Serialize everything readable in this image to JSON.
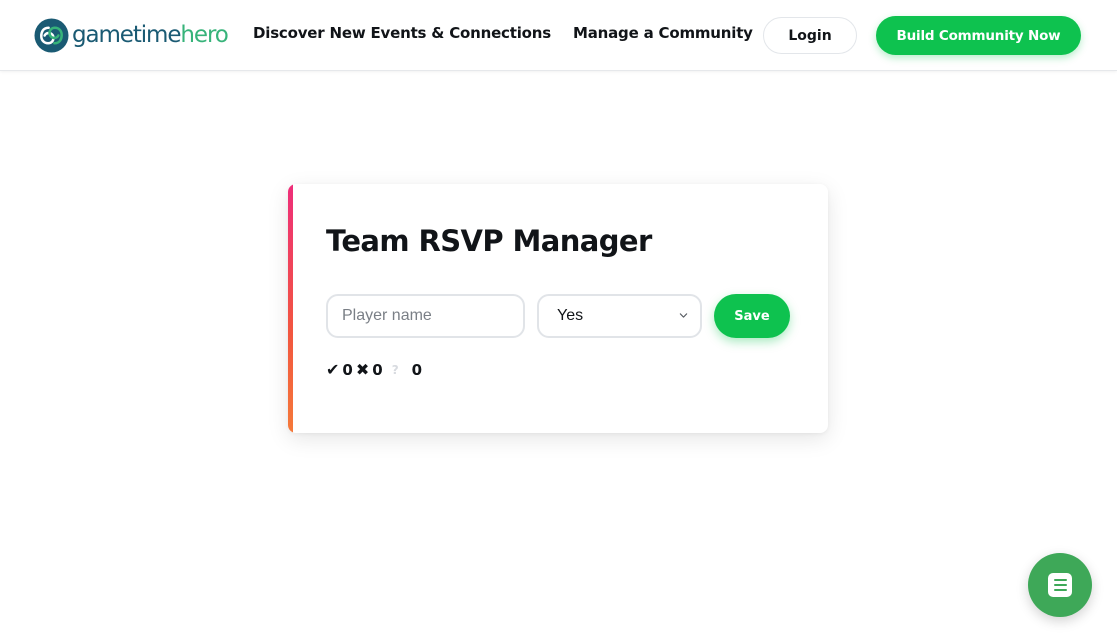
{
  "header": {
    "logo": {
      "part1": "gametime",
      "part2": "hero"
    },
    "nav": {
      "discover": "Discover New Events & Connections",
      "manage": "Manage a Community"
    },
    "login_label": "Login",
    "build_label": "Build Community Now"
  },
  "rsvp": {
    "title": "Team RSVP Manager",
    "player_placeholder": "Player name",
    "player_value": "",
    "status_selected": "Yes",
    "save_label": "Save",
    "counts": {
      "yes": "0",
      "no": "0",
      "maybe": "0"
    }
  },
  "icons": {
    "yes": "check-icon",
    "no": "cross-icon",
    "maybe": "question-icon",
    "chat": "chat-icon"
  },
  "colors": {
    "brand_green": "#0ec24f",
    "logo_teal": "#1a5a73",
    "logo_green": "#37b37a",
    "accent_top": "#ee2e7a",
    "accent_bottom": "#f5793a",
    "fab_green": "#3ea858"
  }
}
